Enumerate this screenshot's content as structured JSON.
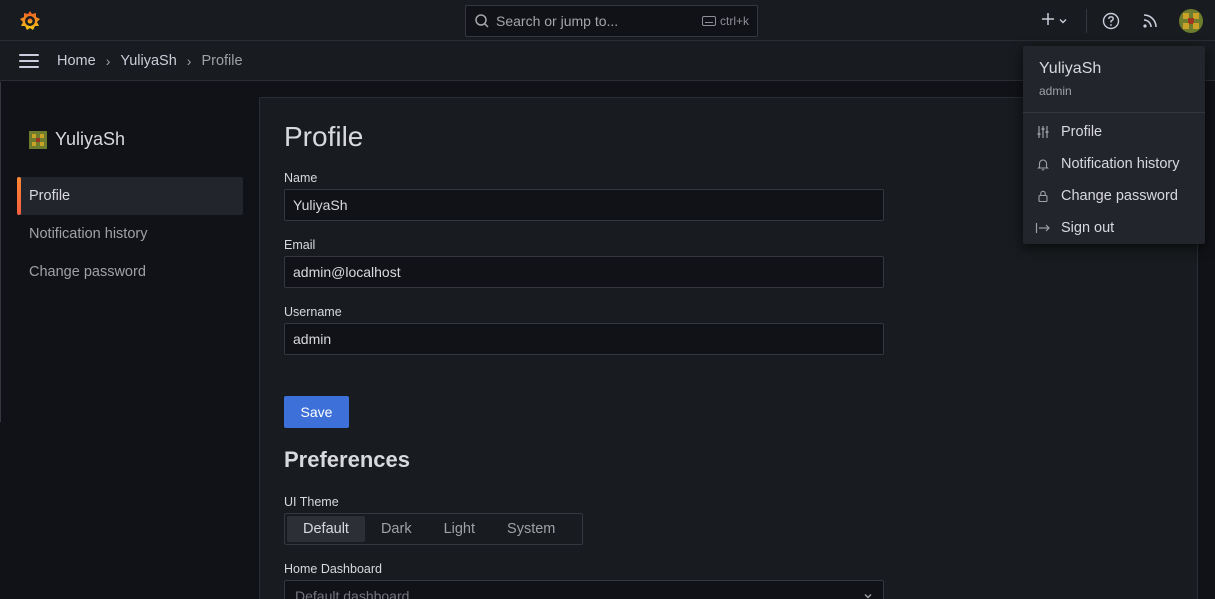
{
  "topbar": {
    "search_placeholder": "Search or jump to...",
    "search_shortcut": "ctrl+k",
    "icons": [
      "grafana-logo-icon",
      "search-icon",
      "keyboard-icon",
      "plus-icon",
      "chevron-down-icon",
      "help-icon",
      "news-icon",
      "avatar"
    ]
  },
  "breadcrumb": [
    {
      "label": "Home"
    },
    {
      "label": "YuliyaSh"
    },
    {
      "label": "Profile"
    }
  ],
  "sidebar": {
    "user_name": "YuliyaSh",
    "items": [
      {
        "label": "Profile",
        "active": true
      },
      {
        "label": "Notification history",
        "active": false
      },
      {
        "label": "Change password",
        "active": false
      }
    ]
  },
  "profile": {
    "title": "Profile",
    "name_label": "Name",
    "name_value": "YuliyaSh",
    "email_label": "Email",
    "email_value": "admin@localhost",
    "username_label": "Username",
    "username_value": "admin",
    "save_label": "Save"
  },
  "preferences": {
    "title": "Preferences",
    "theme_label": "UI Theme",
    "theme_options": [
      "Default",
      "Dark",
      "Light",
      "System"
    ],
    "theme_selected": "Default",
    "home_dashboard_label": "Home Dashboard",
    "home_dashboard_value": "Default dashboard"
  },
  "profile_menu": {
    "user_name": "YuliyaSh",
    "user_login": "admin",
    "items": [
      {
        "label": "Profile",
        "icon": "sliders-icon"
      },
      {
        "label": "Notification history",
        "icon": "bell-icon"
      },
      {
        "label": "Change password",
        "icon": "lock-icon"
      },
      {
        "label": "Sign out",
        "icon": "sign-out-icon"
      }
    ]
  },
  "colors": {
    "accent": "#3d71d9",
    "active_bar": "#f55f3e",
    "background": "#111217",
    "panel": "#181b1f"
  }
}
